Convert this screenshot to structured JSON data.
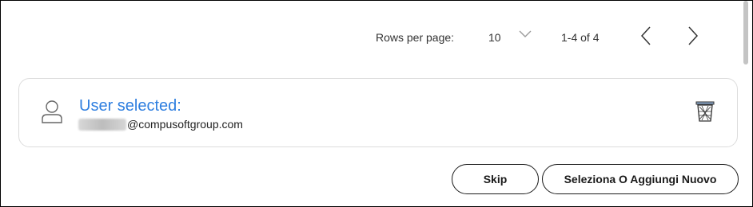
{
  "pagination": {
    "rows_per_page_label": "Rows per page:",
    "rows_per_page_value": "10",
    "range_text": "1-4 of 4"
  },
  "user_card": {
    "title": "User selected:",
    "email_domain": "@compusoftgroup.com"
  },
  "actions": {
    "skip_label": "Skip",
    "select_or_add_label": "Seleziona O Aggiungi Nuovo"
  },
  "icons": {
    "rows_dropdown": "chevron-down-icon",
    "prev_page": "chevron-left-icon",
    "next_page": "chevron-right-icon",
    "user": "user-icon",
    "delete": "trash-icon"
  },
  "colors": {
    "accent": "#2f7fe0",
    "border": "#dcdcdc",
    "text": "#1a1a1a"
  }
}
